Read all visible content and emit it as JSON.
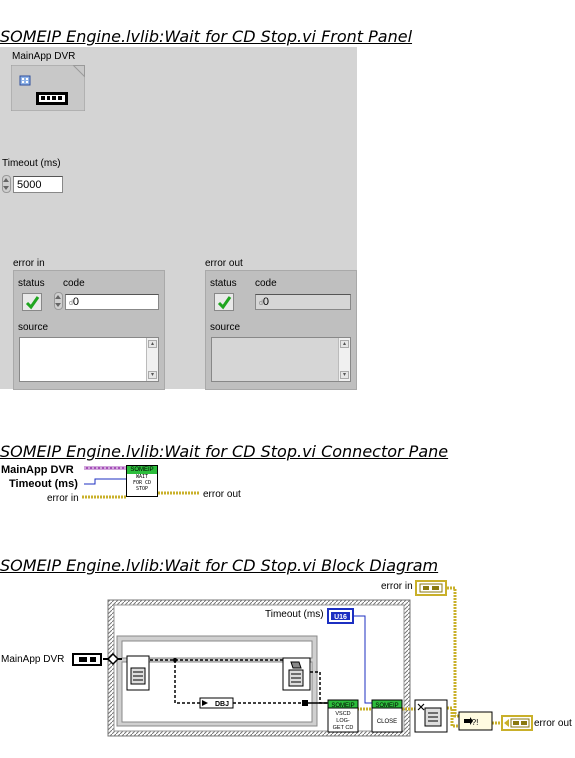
{
  "front_panel": {
    "title": "SOMEIP Engine.lvlib:Wait for CD Stop.vi Front Panel",
    "mainapp_dvr": {
      "label": "MainApp DVR"
    },
    "timeout": {
      "label": "Timeout (ms)",
      "value": "5000"
    },
    "error_in": {
      "label": "error in",
      "status_label": "status",
      "code_label": "code",
      "code_value": "0",
      "source_label": "source",
      "source_value": ""
    },
    "error_out": {
      "label": "error out",
      "status_label": "status",
      "code_label": "code",
      "code_value": "0",
      "code_prefix": "d",
      "source_label": "source",
      "source_value": ""
    }
  },
  "connector_pane": {
    "title": "SOMEIP Engine.lvlib:Wait for CD Stop.vi Connector Pane",
    "inputs": [
      "MainApp DVR",
      "Timeout (ms)",
      "error in"
    ],
    "outputs": [
      "error out"
    ],
    "icon": {
      "banner": "SOMEIP",
      "text": [
        "WAIT",
        "FOR CD",
        "STOP"
      ]
    }
  },
  "block_diagram": {
    "title": "SOMEIP Engine.lvlib:Wait for CD Stop.vi Block Diagram",
    "terminals": {
      "mainapp_dvr": "MainApp DVR",
      "timeout": "Timeout (ms)",
      "timeout_type": "U16",
      "error_in": "error in",
      "error_out": "error out"
    },
    "constant_type": "DBJ",
    "subvis": [
      {
        "banner": "SOMEIP",
        "text": [
          "VSCD",
          "LOG-",
          "GET CD"
        ]
      },
      {
        "banner": "SOMEIP",
        "text": [
          "CLOSE"
        ]
      }
    ],
    "merge_label": "?!"
  },
  "colors": {
    "panel_bg": "#d4d4d4",
    "dvr_wire": "#a54fb8",
    "numeric_wire": "#1c2fc2",
    "error_wire": "#c9b02a",
    "status_ok": "#1fa51f",
    "subvi_banner": "#2cbd3c"
  }
}
